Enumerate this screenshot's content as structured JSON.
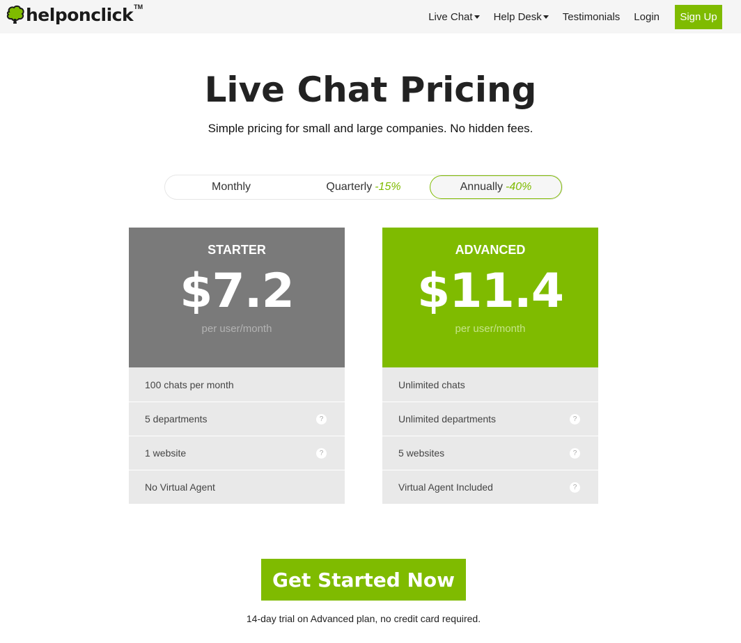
{
  "brand": {
    "name": "helponclick",
    "tm": "TM",
    "logo_icon": "tree-icon",
    "accent": "#7fbb00"
  },
  "nav": {
    "live_chat": "Live Chat",
    "help_desk": "Help Desk",
    "testimonials": "Testimonials",
    "login": "Login",
    "signup": "Sign Up"
  },
  "hero": {
    "title": "Live Chat Pricing",
    "subtitle": "Simple pricing for small and large companies. No hidden fees."
  },
  "billing": {
    "monthly": "Monthly",
    "quarterly": "Quarterly",
    "quarterly_discount": "-15%",
    "annually": "Annually",
    "annually_discount": "-40%",
    "selected": "Annually"
  },
  "plans": [
    {
      "name": "STARTER",
      "price": "$7.2",
      "unit": "per user/month",
      "color": "#7a7a7a",
      "features": [
        {
          "text": "100 chats per month"
        },
        {
          "text": "5 departments",
          "help": "?"
        },
        {
          "text": "1 website",
          "help": "?"
        },
        {
          "text": "No Virtual Agent"
        }
      ]
    },
    {
      "name": "ADVANCED",
      "price": "$11.4",
      "unit": "per user/month",
      "color": "#7fbb00",
      "features": [
        {
          "text": "Unlimited chats"
        },
        {
          "text": "Unlimited departments",
          "help": "?"
        },
        {
          "text": "5 websites",
          "help": "?"
        },
        {
          "text": "Virtual Agent Included",
          "help": "?"
        }
      ]
    }
  ],
  "cta": {
    "label": "Get Started Now",
    "note": "14-day trial on Advanced plan, no credit card required."
  }
}
